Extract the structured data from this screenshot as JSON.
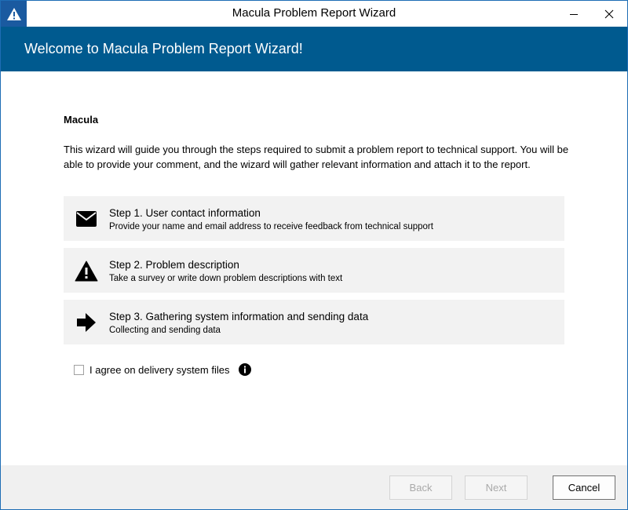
{
  "window": {
    "title": "Macula Problem Report Wizard",
    "icons": {
      "app": "warning-icon",
      "minimize": "minimize-icon",
      "close": "close-icon"
    }
  },
  "banner": {
    "title": "Welcome to Macula Problem Report Wizard!"
  },
  "content": {
    "product_name": "Macula",
    "intro": "This wizard will guide you through the steps required to submit a problem report to technical support. You will be able to provide your comment, and the wizard will gather relevant information and attach it to the report.",
    "steps": [
      {
        "icon": "envelope-icon",
        "title": "Step 1. User contact information",
        "description": "Provide your name and email address to receive feedback from technical support"
      },
      {
        "icon": "warning-icon",
        "title": "Step 2. Problem description",
        "description": "Take a survey or write down problem descriptions with text"
      },
      {
        "icon": "arrow-right-icon",
        "title": "Step 3. Gathering system information and sending data",
        "description": "Collecting and sending data"
      }
    ],
    "agreement": {
      "label": "I agree on delivery system files",
      "checked": false,
      "info_icon": "info-icon"
    }
  },
  "footer": {
    "back_label": "Back",
    "next_label": "Next",
    "cancel_label": "Cancel"
  },
  "colors": {
    "banner": "#005a8f",
    "app_icon_bg": "#1a5aa0",
    "step_bg": "#f2f2f2",
    "footer_bg": "#f0f0f0",
    "disabled_text": "#a9a9a9"
  }
}
